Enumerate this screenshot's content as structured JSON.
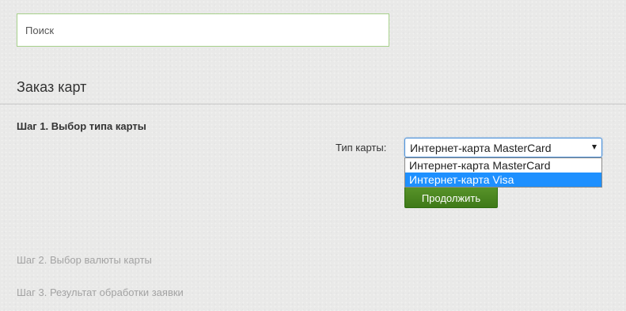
{
  "search": {
    "placeholder": "Поиск",
    "value": ""
  },
  "page": {
    "title": "Заказ карт"
  },
  "step1": {
    "title": "Шаг 1. Выбор типа карты",
    "card_type_label": "Тип карты:",
    "card_type_selected": "Интернет-карта MasterCard",
    "card_type_options": [
      "Интернет-карта MasterCard",
      "Интернет-карта Visa"
    ],
    "highlighted_option": "Интернет-карта Visa",
    "continue_label": "Продолжить"
  },
  "step2": {
    "title": "Шаг 2. Выбор валюты карты"
  },
  "step3": {
    "title": "Шаг 3. Результат обработки заявки"
  },
  "colors": {
    "button_green": "#4f8a23",
    "option_highlight": "#1e90ff",
    "muted_text": "#a3a3a3",
    "search_border": "#a6d08a"
  },
  "icons": {
    "select_arrow": "chevron-down-icon"
  }
}
